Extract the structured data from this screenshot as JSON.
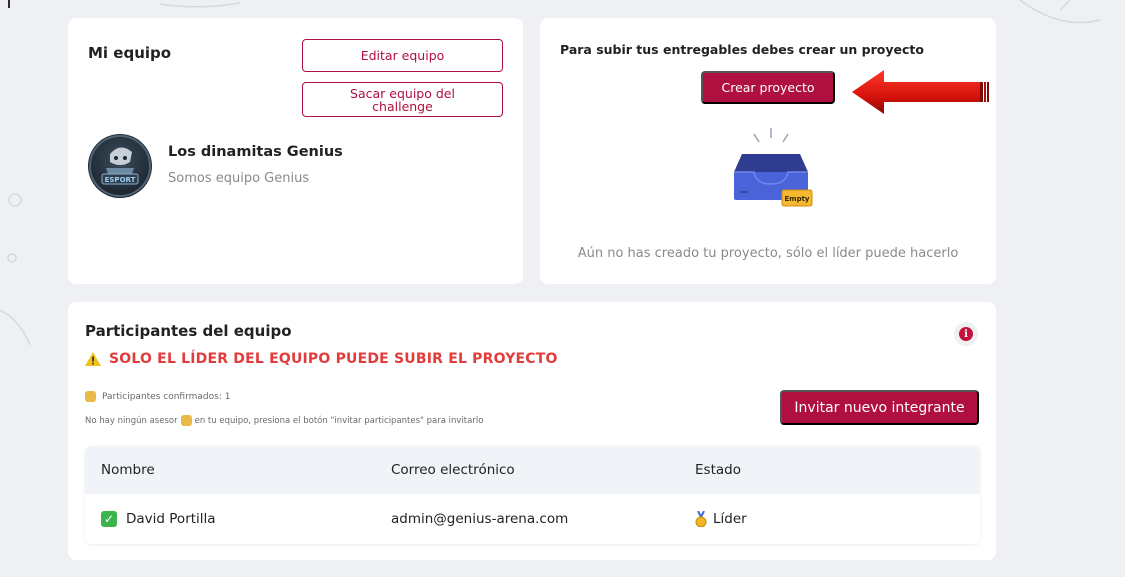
{
  "team_card": {
    "title": "Mi equipo",
    "edit_button": "Editar equipo",
    "remove_button": "Sacar equipo del challenge",
    "team_name": "Los dinamitas Genius",
    "team_description": "Somos equipo Genius",
    "avatar_text": "ESPORT"
  },
  "project_card": {
    "title": "Para subir tus entregables debes crear un proyecto",
    "create_button": "Crear proyecto",
    "empty_badge": "Empty",
    "empty_message": "Aún no has creado tu proyecto, sólo el líder puede hacerlo"
  },
  "participants_card": {
    "title": "Participantes del equipo",
    "warning": "SOLO EL LÍDER DEL EQUIPO PUEDE SUBIR EL PROYECTO",
    "confirmed": "Participantes confirmados: 1",
    "no_advisor_before": "No hay ningún asesor",
    "no_advisor_after": "en tu equipo, presiona el botón \"invitar participantes\" para invitarlo",
    "invite_button": "Invitar nuevo integrante",
    "table": {
      "headers": [
        "Nombre",
        "Correo electrónico",
        "Estado"
      ],
      "rows": [
        {
          "name": "David Portilla",
          "email": "admin@genius-arena.com",
          "status": "Líder"
        }
      ]
    }
  },
  "colors": {
    "accent": "#b0103f",
    "warning": "#e23b3b",
    "background": "#eef0f4",
    "confirm_green": "#3bb54a"
  },
  "icons": [
    "info-icon",
    "warning-icon",
    "check-icon",
    "medal-icon",
    "empty-inbox-icon",
    "arrow-icon"
  ]
}
